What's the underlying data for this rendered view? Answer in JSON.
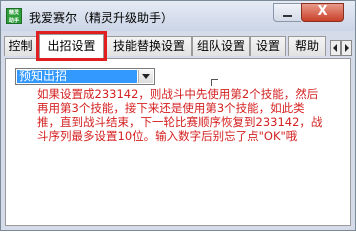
{
  "window": {
    "title": "我爱赛尔（精灵升级助手）",
    "icon_text_top": "精灵",
    "icon_text_bottom": "助手",
    "close_glyph": "X"
  },
  "tabs": [
    {
      "label": "控制",
      "active": false
    },
    {
      "label": "出招设置",
      "active": true
    },
    {
      "label": "技能替换设置",
      "active": false
    },
    {
      "label": "组队设置",
      "active": false
    },
    {
      "label": "设置",
      "active": false
    },
    {
      "label": "帮助",
      "active": false
    }
  ],
  "skill_select": {
    "value": "预知出招"
  },
  "help_text": "如果设置成233142，则战斗中先使用第2个技能，然后再用第3个技能，接下来还是使用第3个技能，如此类推，直到战斗结束，下一轮比赛顺序恢复到233142，战斗序列最多设置10位。输入数字后别忘了点\"OK\"哦",
  "colors": {
    "highlight_box": "#e02020",
    "help_text": "#d42020",
    "selection": "#3399ff"
  }
}
